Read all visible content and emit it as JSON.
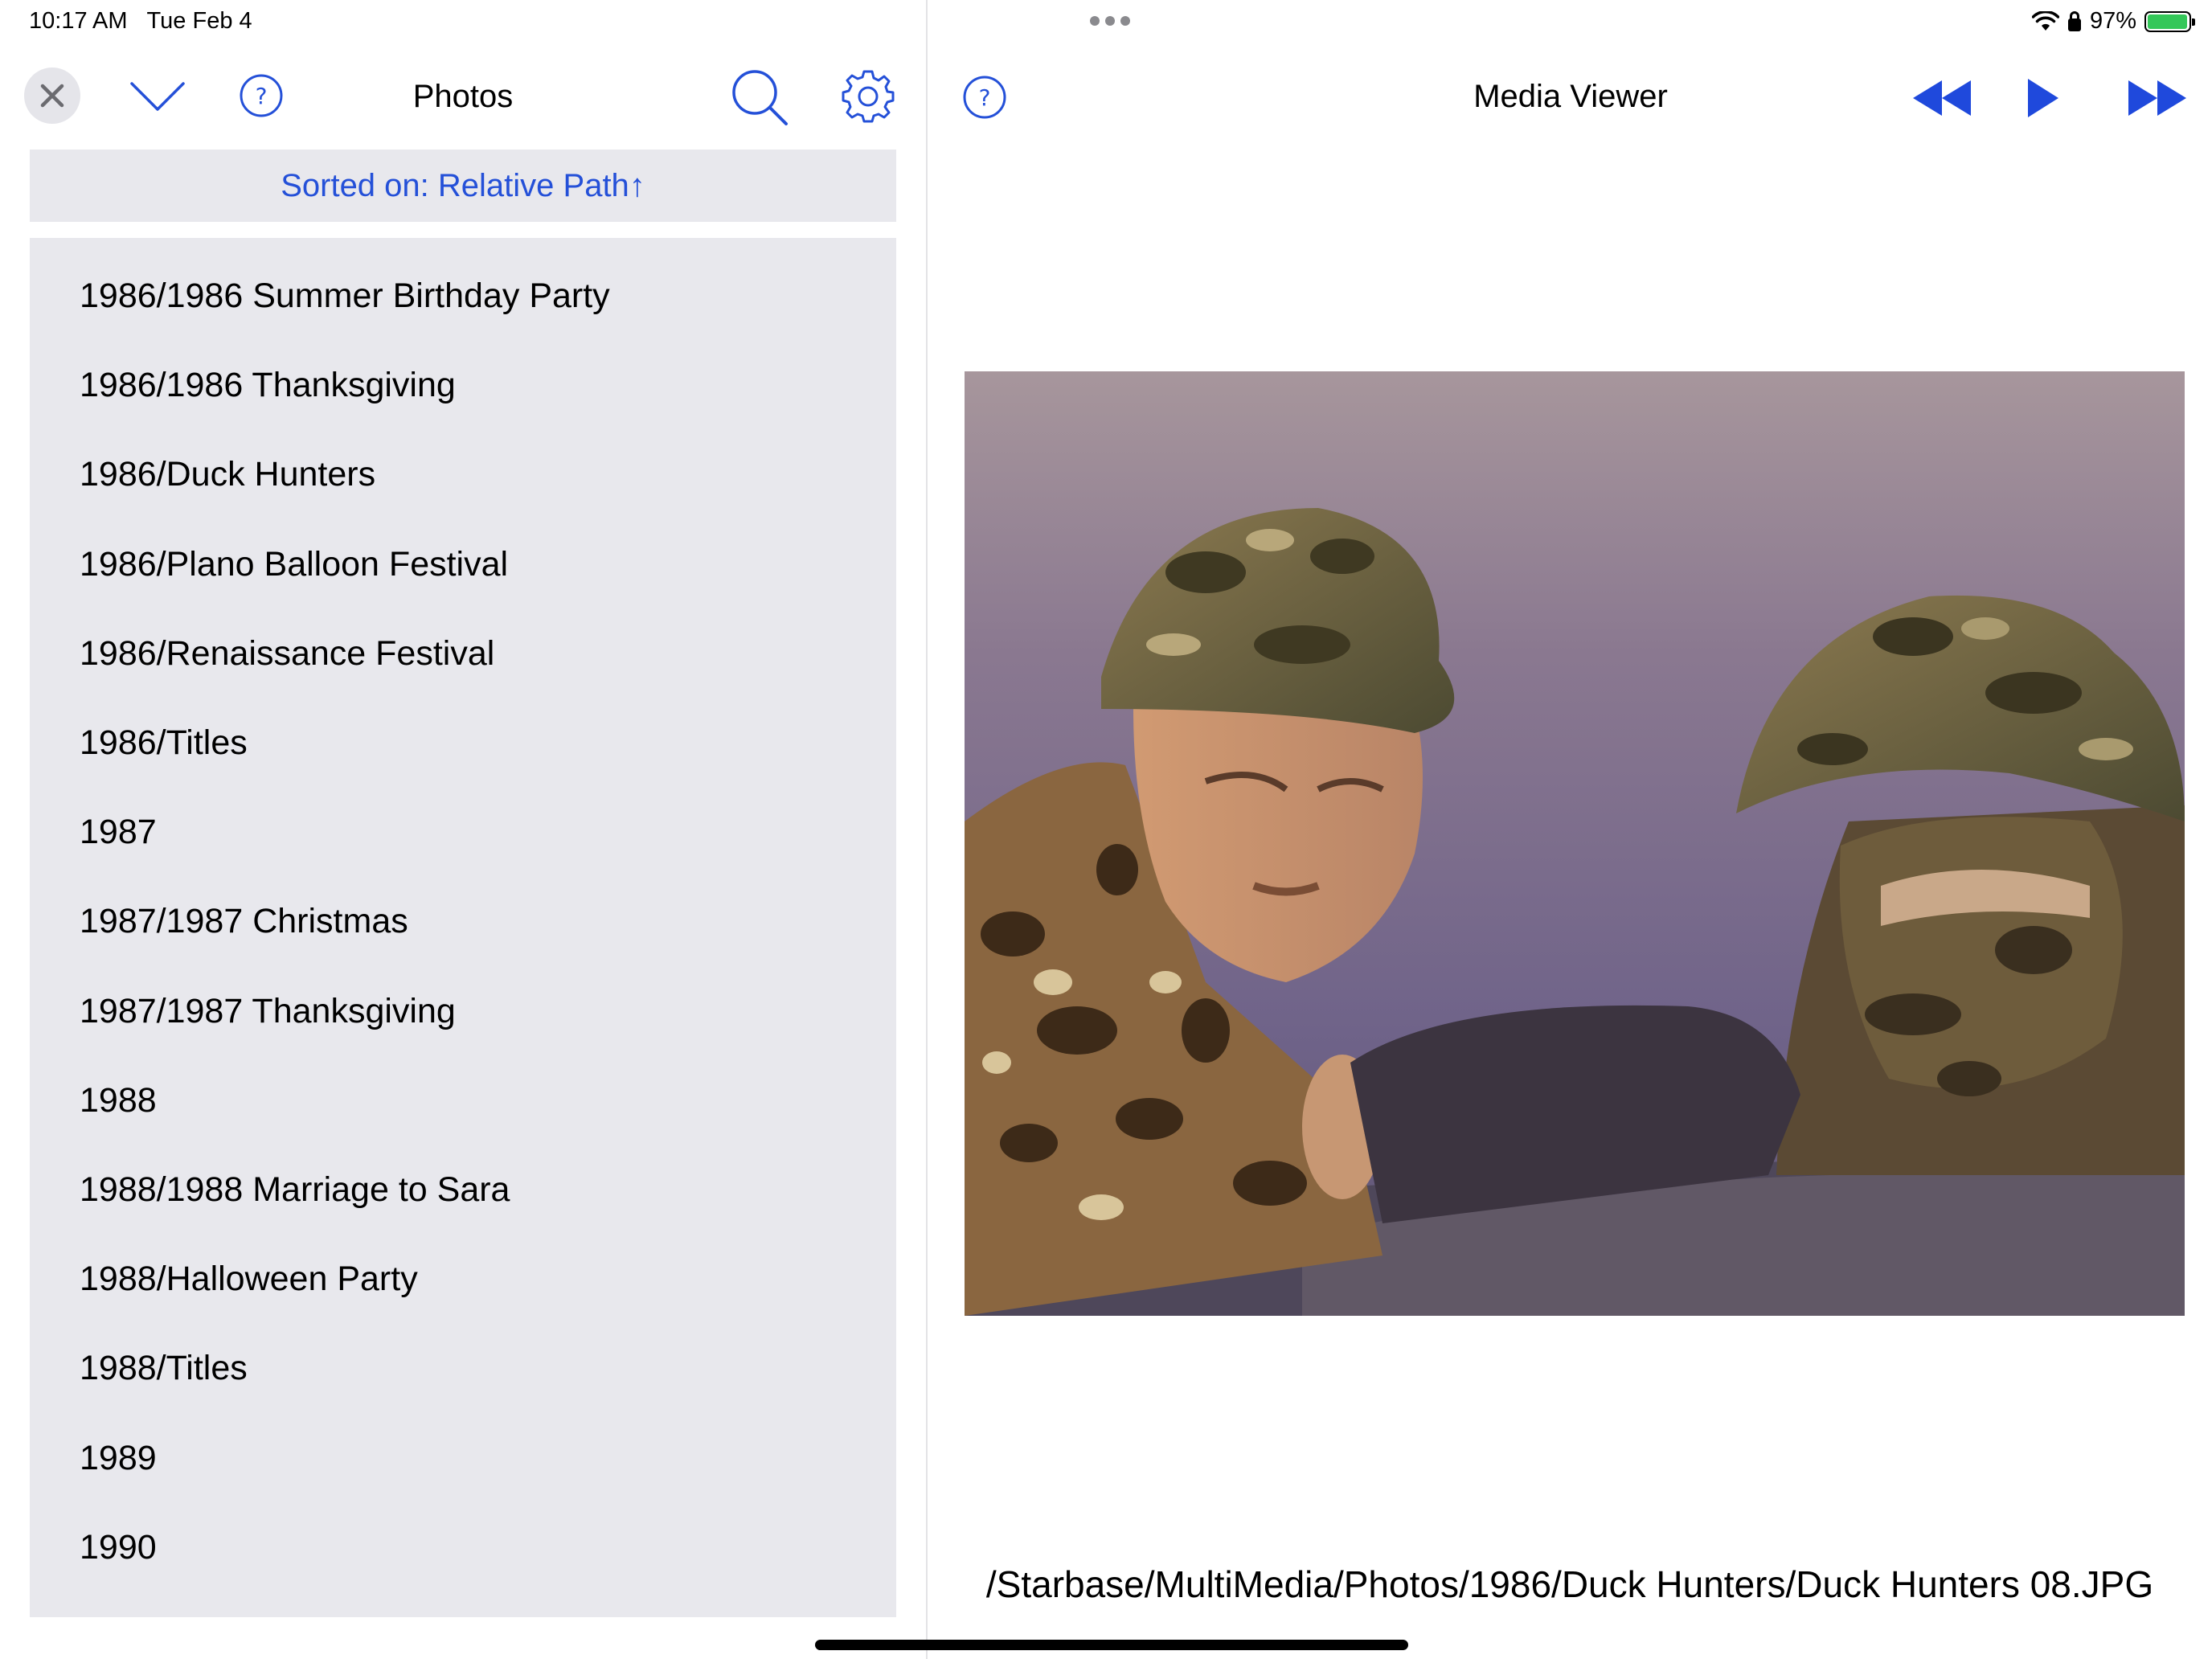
{
  "status_bar": {
    "time": "10:17 AM",
    "date": "Tue Feb 4",
    "battery_percent": "97%",
    "battery_level": 0.97
  },
  "left_pane": {
    "title": "Photos",
    "sort_label": "Sorted on: Relative Path↑",
    "items": [
      "1986/1986 Summer Birthday Party",
      "1986/1986 Thanksgiving",
      "1986/Duck Hunters",
      "1986/Plano Balloon Festival",
      "1986/Renaissance Festival",
      "1986/Titles",
      "1987",
      "1987/1987 Christmas",
      "1987/1987 Thanksgiving",
      "1988",
      "1988/1988 Marriage to Sara",
      "1988/Halloween Party",
      "1988/Titles",
      "1989",
      "1990"
    ]
  },
  "right_pane": {
    "title": "Media Viewer",
    "file_path": "/Starbase/MultiMedia/Photos/1986/Duck Hunters/Duck Hunters 08.JPG"
  },
  "icons": {
    "close": "close-icon",
    "collapse": "chevron-down-icon",
    "help": "help-icon",
    "search": "search-icon",
    "settings": "gear-icon",
    "previous": "rewind-icon",
    "play": "play-icon",
    "next": "fast-forward-icon"
  },
  "colors": {
    "accent": "#2450d8",
    "panel_background": "#e8e8ed",
    "battery_green": "#34c759"
  }
}
